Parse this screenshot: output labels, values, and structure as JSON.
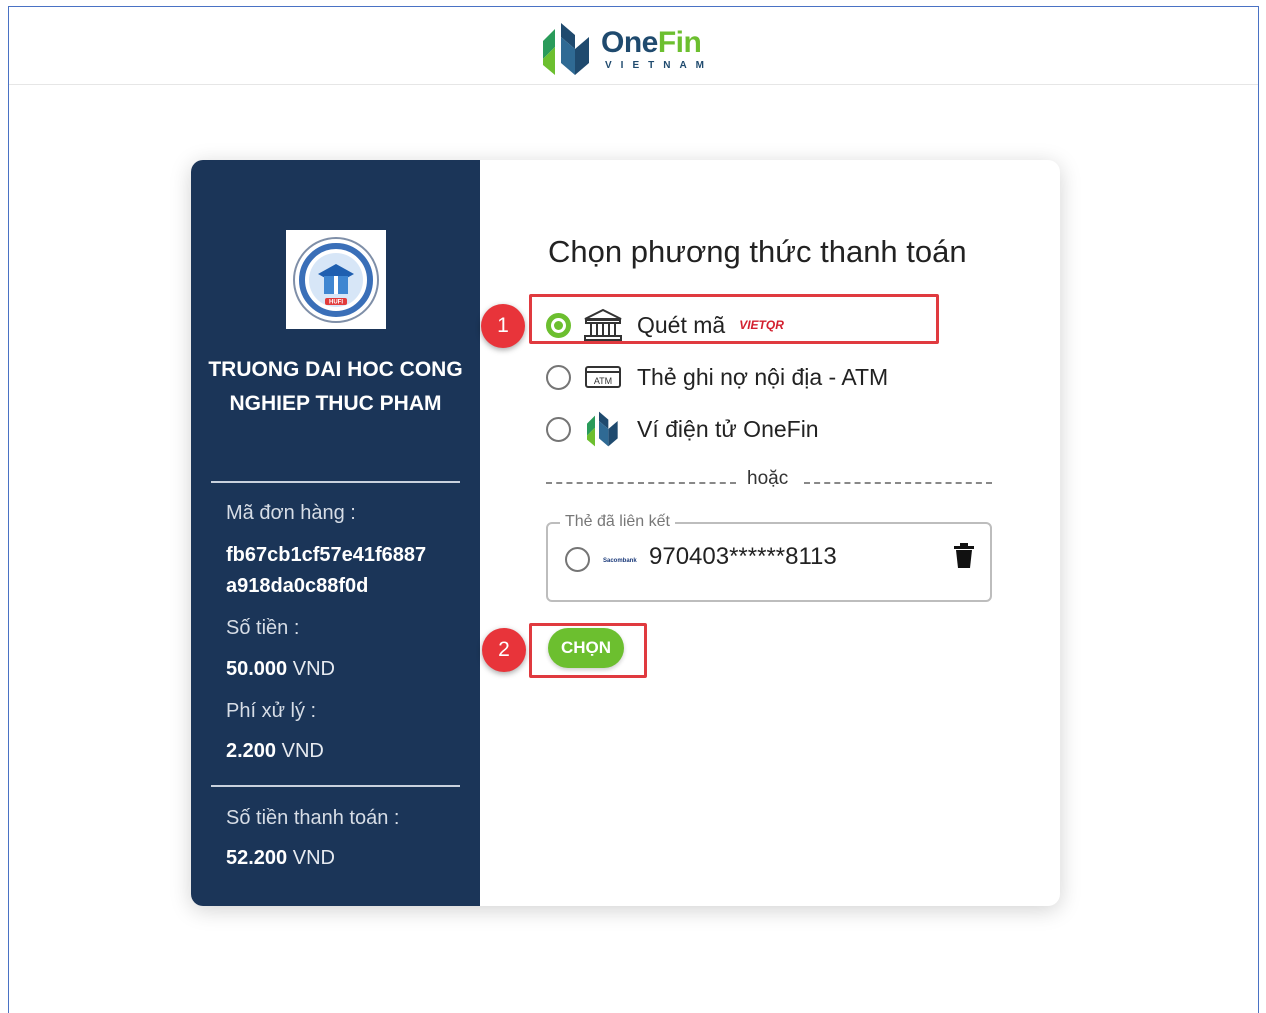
{
  "brand": {
    "name_part1": "One",
    "name_part2": "Fin",
    "sub": "VIETNAM"
  },
  "merchant": {
    "name": "TRUONG DAI HOC CONG NGHIEP THUC PHAM",
    "logo_text": "HUFI"
  },
  "order": {
    "order_id_label": "Mã đơn hàng :",
    "order_id_line1": "fb67cb1cf57e41f6887",
    "order_id_line2": "a918da0c88f0d",
    "amount_label": "Số tiền :",
    "amount_value": "50.000",
    "amount_unit": "VND",
    "fee_label": "Phí xử lý :",
    "fee_value": "2.200",
    "fee_unit": "VND",
    "total_label": "Số tiền thanh toán :",
    "total_value": "52.200",
    "total_unit": "VND"
  },
  "payment": {
    "title": "Chọn phương thức thanh toán",
    "options": [
      {
        "label": "Quét mã",
        "badge": "VIETQR",
        "icon": "bank-icon",
        "selected": true
      },
      {
        "label": "Thẻ ghi nợ nội địa - ATM",
        "icon": "atm-card-icon",
        "selected": false
      },
      {
        "label": "Ví điện tử OneFin",
        "icon": "onefin-wallet-icon",
        "selected": false
      }
    ],
    "or_text": "hoặc",
    "linked_legend": "Thẻ đã liên kết",
    "linked_bank": "Sacombank",
    "linked_card": "970403******8113",
    "choose_button": "CHỌN"
  },
  "annotations": {
    "step1": "1",
    "step2": "2"
  },
  "colors": {
    "accent": "#6cbf2f",
    "sidebar": "#1b3558",
    "highlight": "#e03a3f"
  }
}
